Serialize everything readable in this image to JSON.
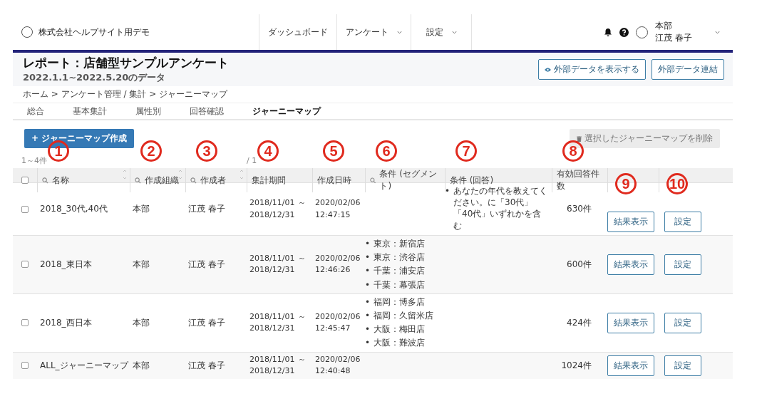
{
  "header": {
    "company": "株式会社ヘルプサイト用デモ",
    "nav": [
      {
        "label": "ダッシュボード",
        "dropdown": false
      },
      {
        "label": "アンケート",
        "dropdown": true
      },
      {
        "label": "設定",
        "dropdown": true
      }
    ],
    "user": {
      "org": "本部",
      "name": "江茂 春子"
    }
  },
  "report": {
    "title": "レポート：店舗型サンプルアンケート",
    "subtitle": "2022.1.1~2022.5.20のデータ",
    "buttons": [
      {
        "label": "外部データを表示する"
      },
      {
        "label": "外部データ連結"
      }
    ]
  },
  "breadcrumb": "ホーム > アンケート管理 / 集計 > ジャーニーマップ",
  "tabs": [
    {
      "label": "総合",
      "selected": false
    },
    {
      "label": "基本集計",
      "selected": false
    },
    {
      "label": "属性別",
      "selected": false
    },
    {
      "label": "回答確認",
      "selected": false
    },
    {
      "label": "ジャーニーマップ",
      "selected": true
    }
  ],
  "create_button": "+ ジャーニーマップ作成",
  "delete_button": {
    "label": "選択したジャーニーマップを削除",
    "disabled": true
  },
  "pagination": {
    "summary": "1～4件",
    "page": "/ 1"
  },
  "table": {
    "header_checked": false,
    "bullet": "•",
    "columns": [
      {
        "label": "名称",
        "search": true,
        "sortable": true,
        "callout": "1"
      },
      {
        "label": "作成組織",
        "search": true,
        "sortable": true,
        "callout": "2"
      },
      {
        "label": "作成者",
        "search": true,
        "sortable": true,
        "callout": "3"
      },
      {
        "label": "集計期間",
        "search": false,
        "sortable": false,
        "callout": "4"
      },
      {
        "label": "作成日時",
        "search": false,
        "sortable": false,
        "callout": "5"
      },
      {
        "label": "条件 (セグメント)",
        "search": true,
        "sortable": false,
        "callout": "6"
      },
      {
        "label": "条件 (回答)",
        "search": false,
        "sortable": false,
        "callout": "7"
      },
      {
        "label": "有効回答件数",
        "search": false,
        "sortable": false,
        "callout": "8"
      },
      {
        "search": false,
        "sortable": false,
        "callout": "9"
      },
      {
        "search": false,
        "sortable": false,
        "callout": "10"
      }
    ],
    "rows": [
      {
        "checked": false,
        "name": "2018_30代,40代",
        "org": "本部",
        "creator": "江茂 春子",
        "period_start": "2018/11/01",
        "period_sep": "～",
        "period_end": "2018/12/31",
        "created_date": "2020/02/06",
        "created_time": "12:47:15",
        "segments": [],
        "answers": [
          "あなたの年代を教えてください。に「30代」「40代」いずれかを含む"
        ],
        "count": "630件",
        "result_button": "結果表示",
        "settings_button": "設定"
      },
      {
        "checked": false,
        "name": "2018_東日本",
        "org": "本部",
        "creator": "江茂 春子",
        "period_start": "2018/11/01",
        "period_sep": "～",
        "period_end": "2018/12/31",
        "created_date": "2020/02/06",
        "created_time": "12:46:26",
        "segments": [
          "東京：新宿店",
          "東京：渋谷店",
          "千葉：浦安店",
          "千葉：幕張店"
        ],
        "answers": [],
        "count": "600件",
        "result_button": "結果表示",
        "settings_button": "設定"
      },
      {
        "checked": false,
        "name": "2018_西日本",
        "org": "本部",
        "creator": "江茂 春子",
        "period_start": "2018/11/01",
        "period_sep": "～",
        "period_end": "2018/12/31",
        "created_date": "2020/02/06",
        "created_time": "12:45:47",
        "segments": [
          "福岡：博多店",
          "福岡：久留米店",
          "大阪：梅田店",
          "大阪：難波店"
        ],
        "answers": [],
        "count": "424件",
        "result_button": "結果表示",
        "settings_button": "設定"
      },
      {
        "checked": false,
        "name": "ALL_ジャーニーマップ",
        "org": "本部",
        "creator": "江茂 春子",
        "period_start": "2018/11/01",
        "period_sep": "～",
        "period_end": "2018/12/31",
        "created_date": "2020/02/06",
        "created_time": "12:40:48",
        "segments": [],
        "answers": [],
        "count": "1024件",
        "result_button": "結果表示",
        "settings_button": "設定"
      }
    ]
  }
}
